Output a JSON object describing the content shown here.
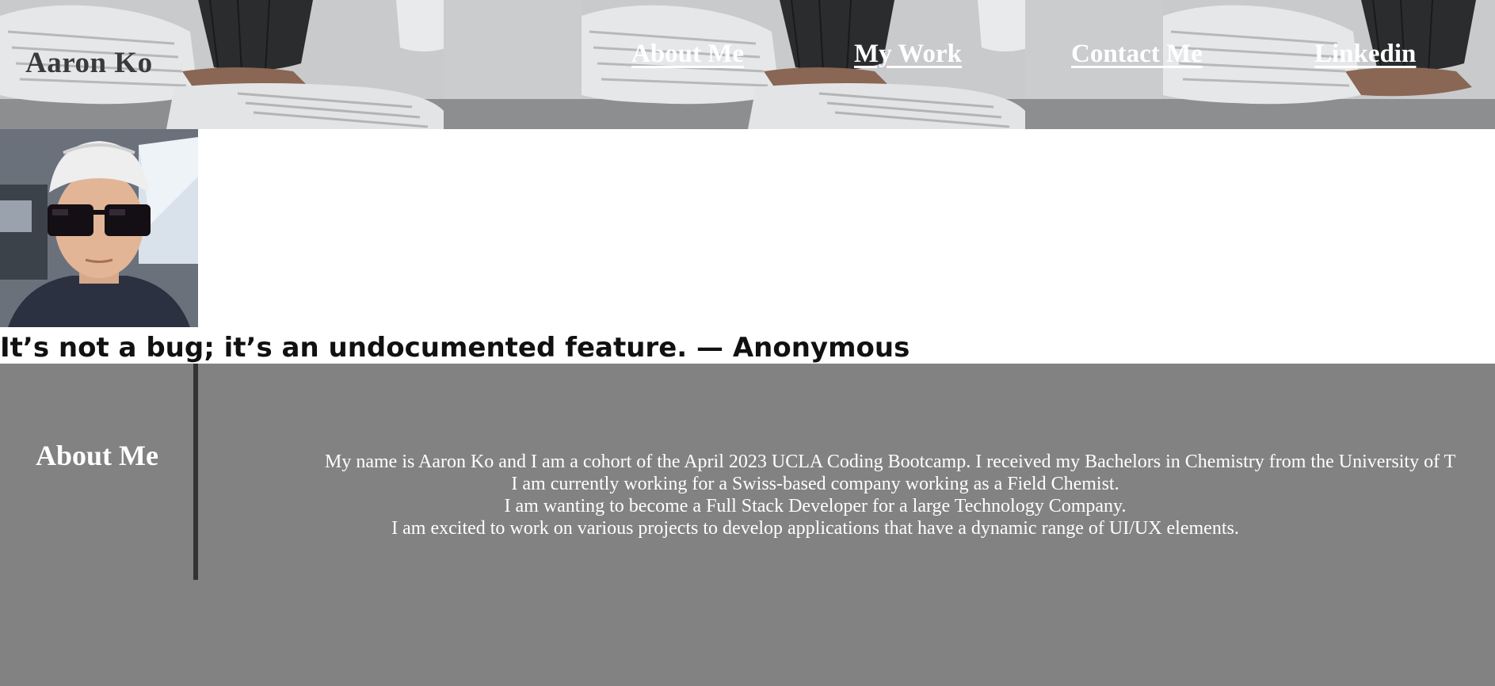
{
  "header": {
    "logo": "Aaron Ko",
    "background": "sneaker-photo-banner",
    "nav": [
      {
        "label": "About Me"
      },
      {
        "label": "My Work"
      },
      {
        "label": "Contact Me"
      },
      {
        "label": "Linkedin"
      }
    ]
  },
  "profile": {
    "photo": "selfie-with-sunglasses"
  },
  "quote": "It’s not a bug; it’s an undocumented feature. — Anonymous",
  "about": {
    "heading": "About Me",
    "lines": [
      "My name is Aaron Ko and I am a cohort of the April 2023 UCLA Coding Bootcamp. I received my Bachelors in Chemistry from the University of T",
      "I am currently working for a Swiss-based company working as a Field Chemist.",
      "I am wanting to become a Full Stack Developer for a large Technology Company.",
      "I am excited to work on various projects to develop applications that have a dynamic range of UI/UX elements."
    ]
  },
  "colors": {
    "about_background": "#828282",
    "divider": "#333333",
    "nav_text": "#ffffff",
    "logo_text": "#3a3a3a"
  }
}
